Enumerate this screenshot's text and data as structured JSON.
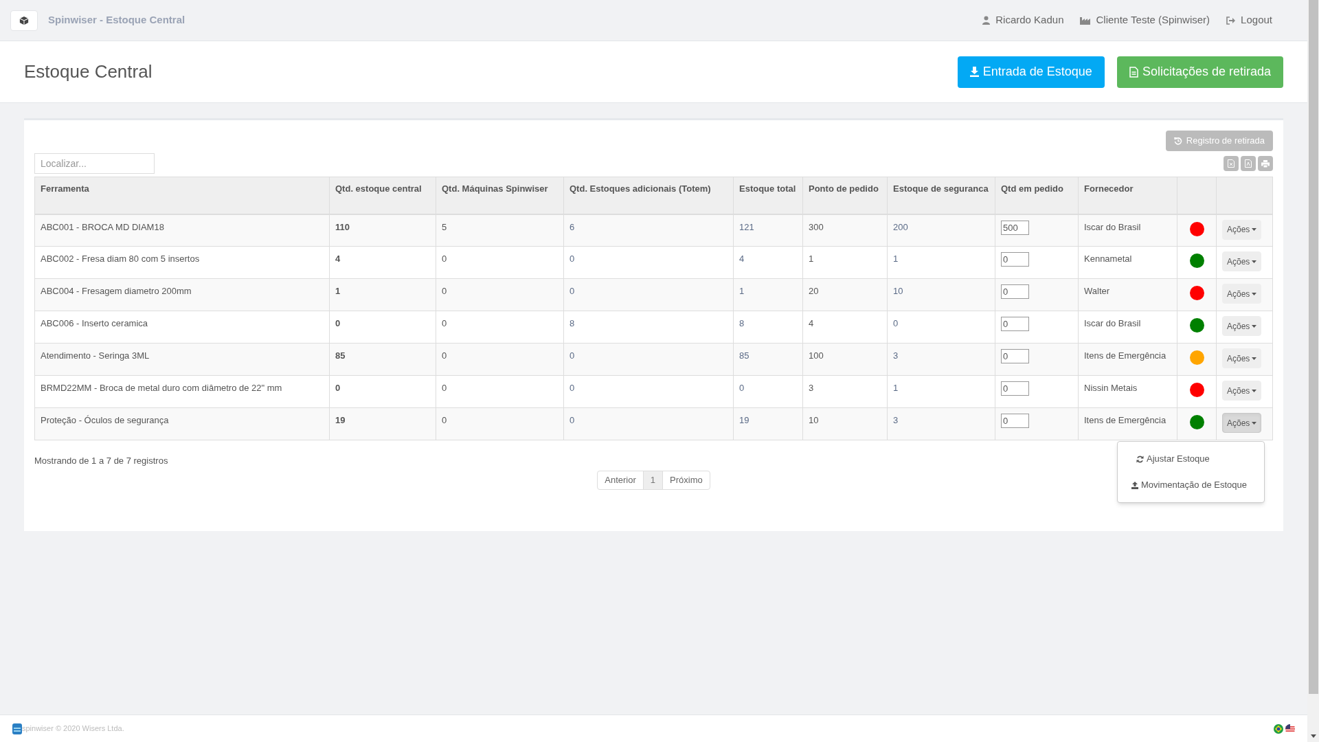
{
  "topbar": {
    "title": "Spinwiser - Estoque Central",
    "user": "Ricardo Kadun",
    "client": "Cliente Teste (Spinwiser)",
    "logout": "Logout"
  },
  "header": {
    "title": "Estoque Central",
    "buttons": [
      {
        "label": "Entrada de Estoque",
        "kind": "primary"
      },
      {
        "label": "Solicitações de retirada",
        "kind": "success"
      }
    ]
  },
  "toolbar": {
    "history_button": "Registro de retirada",
    "search": {
      "placeholder": "Localizar..."
    }
  },
  "table": {
    "columns": [
      "Ferramenta",
      "Qtd. estoque central",
      "Qtd. Máquinas Spinwiser",
      "Qtd. Estoques adicionais (Totem)",
      "Estoque total",
      "Ponto de pedido",
      "Estoque de seguranca",
      "Qtd em pedido",
      "Fornecedor"
    ],
    "rows": [
      {
        "cells": [
          "ABC001 - BROCA MD DIAM18",
          "110",
          "5",
          "6",
          "121",
          "300",
          "200"
        ],
        "ordered": "500",
        "supplier": "Iscar do Brasil",
        "color": "#ff0000",
        "action": "Ações",
        "menu_open": false
      },
      {
        "cells": [
          "ABC002 - Fresa diam 80 com 5 insertos",
          "4",
          "0",
          "0",
          "4",
          "1",
          "1"
        ],
        "ordered": "0",
        "supplier": "Kennametal",
        "color": "#008000",
        "action": "Ações",
        "menu_open": false
      },
      {
        "cells": [
          "ABC004 - Fresagem diametro 200mm",
          "1",
          "0",
          "0",
          "1",
          "20",
          "10"
        ],
        "ordered": "0",
        "supplier": "Walter",
        "color": "#ff0000",
        "action": "Ações",
        "menu_open": false
      },
      {
        "cells": [
          "ABC006 - Inserto ceramica",
          "0",
          "0",
          "8",
          "8",
          "4",
          "0"
        ],
        "ordered": "0",
        "supplier": "Iscar do Brasil",
        "color": "#008000",
        "action": "Ações",
        "menu_open": false
      },
      {
        "cells": [
          "Atendimento - Seringa 3ML",
          "85",
          "0",
          "0",
          "85",
          "100",
          "3"
        ],
        "ordered": "0",
        "supplier": "Itens de Emergência",
        "color": "#ffa500",
        "action": "Ações",
        "menu_open": false
      },
      {
        "cells": [
          "BRMD22MM - Broca de metal duro com diâmetro de 22\" mm",
          "0",
          "0",
          "0",
          "0",
          "3",
          "1"
        ],
        "ordered": "0",
        "supplier": "Nissin Metais",
        "color": "#ff0000",
        "action": "Ações",
        "menu_open": false
      },
      {
        "cells": [
          "Proteção - Óculos de segurança",
          "19",
          "0",
          "0",
          "19",
          "10",
          "3"
        ],
        "ordered": "0",
        "supplier": "Itens de Emergência",
        "color": "#008000",
        "action": "Ações",
        "menu_open": true
      }
    ],
    "menu_items": [
      {
        "label": "Ajustar Estoque",
        "kind": "adjust"
      },
      {
        "label": "Movimentação de Estoque",
        "kind": "move"
      }
    ]
  },
  "info": "Mostrando de 1 a 7 de 7 registros",
  "pagination": [
    {
      "label": "Anterior",
      "selected": false
    },
    {
      "label": "1",
      "selected": true
    },
    {
      "label": "Próximo",
      "selected": false
    }
  ],
  "footer": {
    "text": "spinwiser © 2020 Wisers Ltda."
  }
}
